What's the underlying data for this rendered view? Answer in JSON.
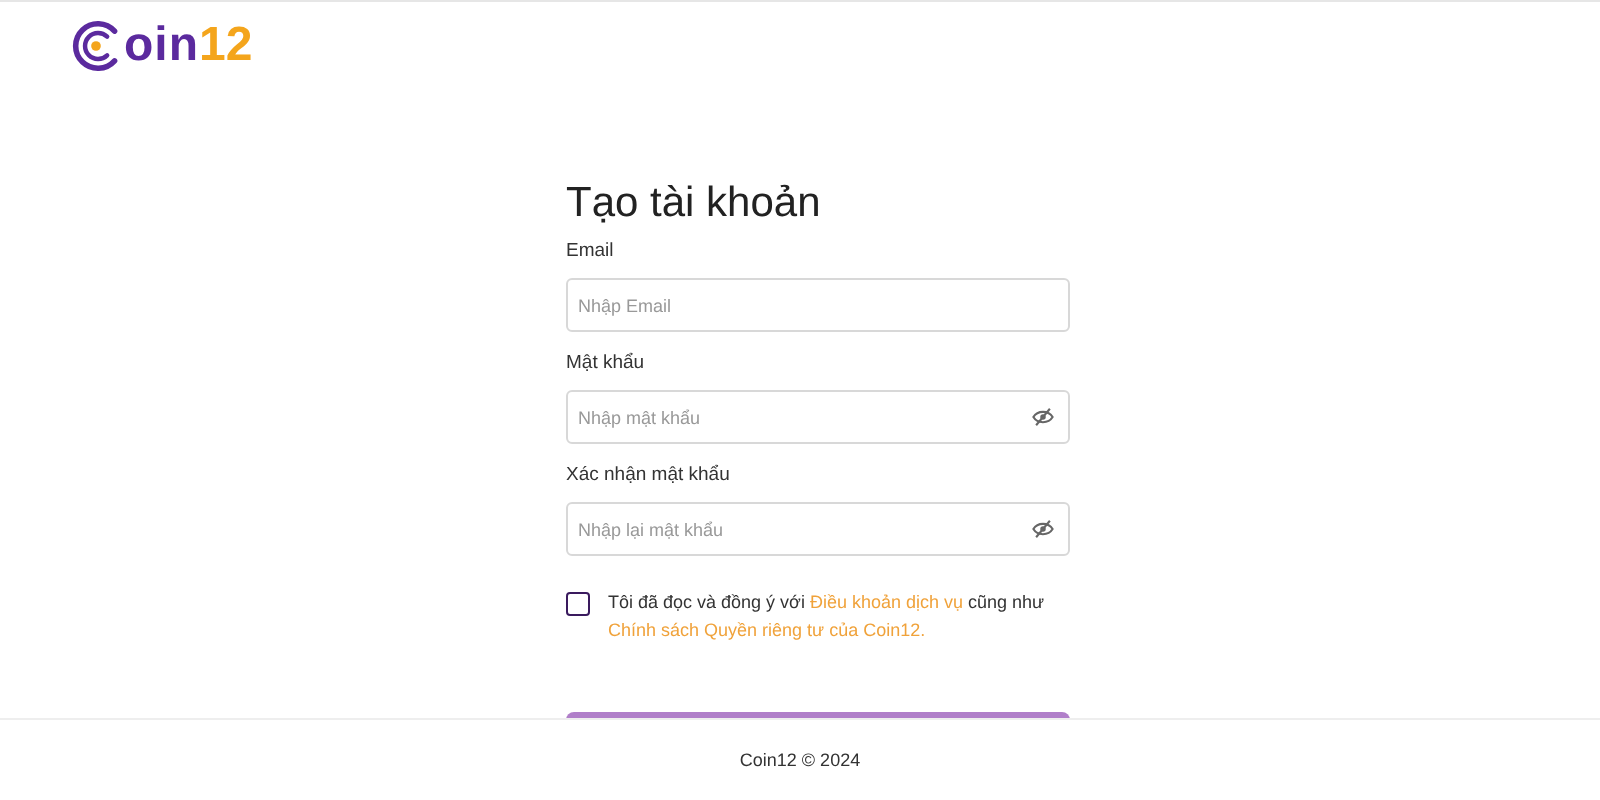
{
  "logo": {
    "word": "oin",
    "number": "12"
  },
  "title": "Tạo tài khoản",
  "fields": [
    {
      "label": "Email",
      "placeholder": "Nhập Email",
      "kind": "text"
    },
    {
      "label": "Mật khẩu",
      "placeholder": "Nhập mật khẩu",
      "kind": "password"
    },
    {
      "label": "Xác nhận mật khẩu",
      "placeholder": "Nhập lại mật khẩu",
      "kind": "password"
    }
  ],
  "agreement": {
    "checked": false,
    "parts": [
      {
        "kind": "plain",
        "text": "Tôi đã đọc và đồng ý với "
      },
      {
        "kind": "link",
        "text": "Điều khoản dịch vụ"
      },
      {
        "kind": "plain",
        "text": " cũng như "
      },
      {
        "kind": "link",
        "text": "Chính sách Quyền riêng tư của Coin12."
      }
    ]
  },
  "footer": "Coin12 © 2024"
}
